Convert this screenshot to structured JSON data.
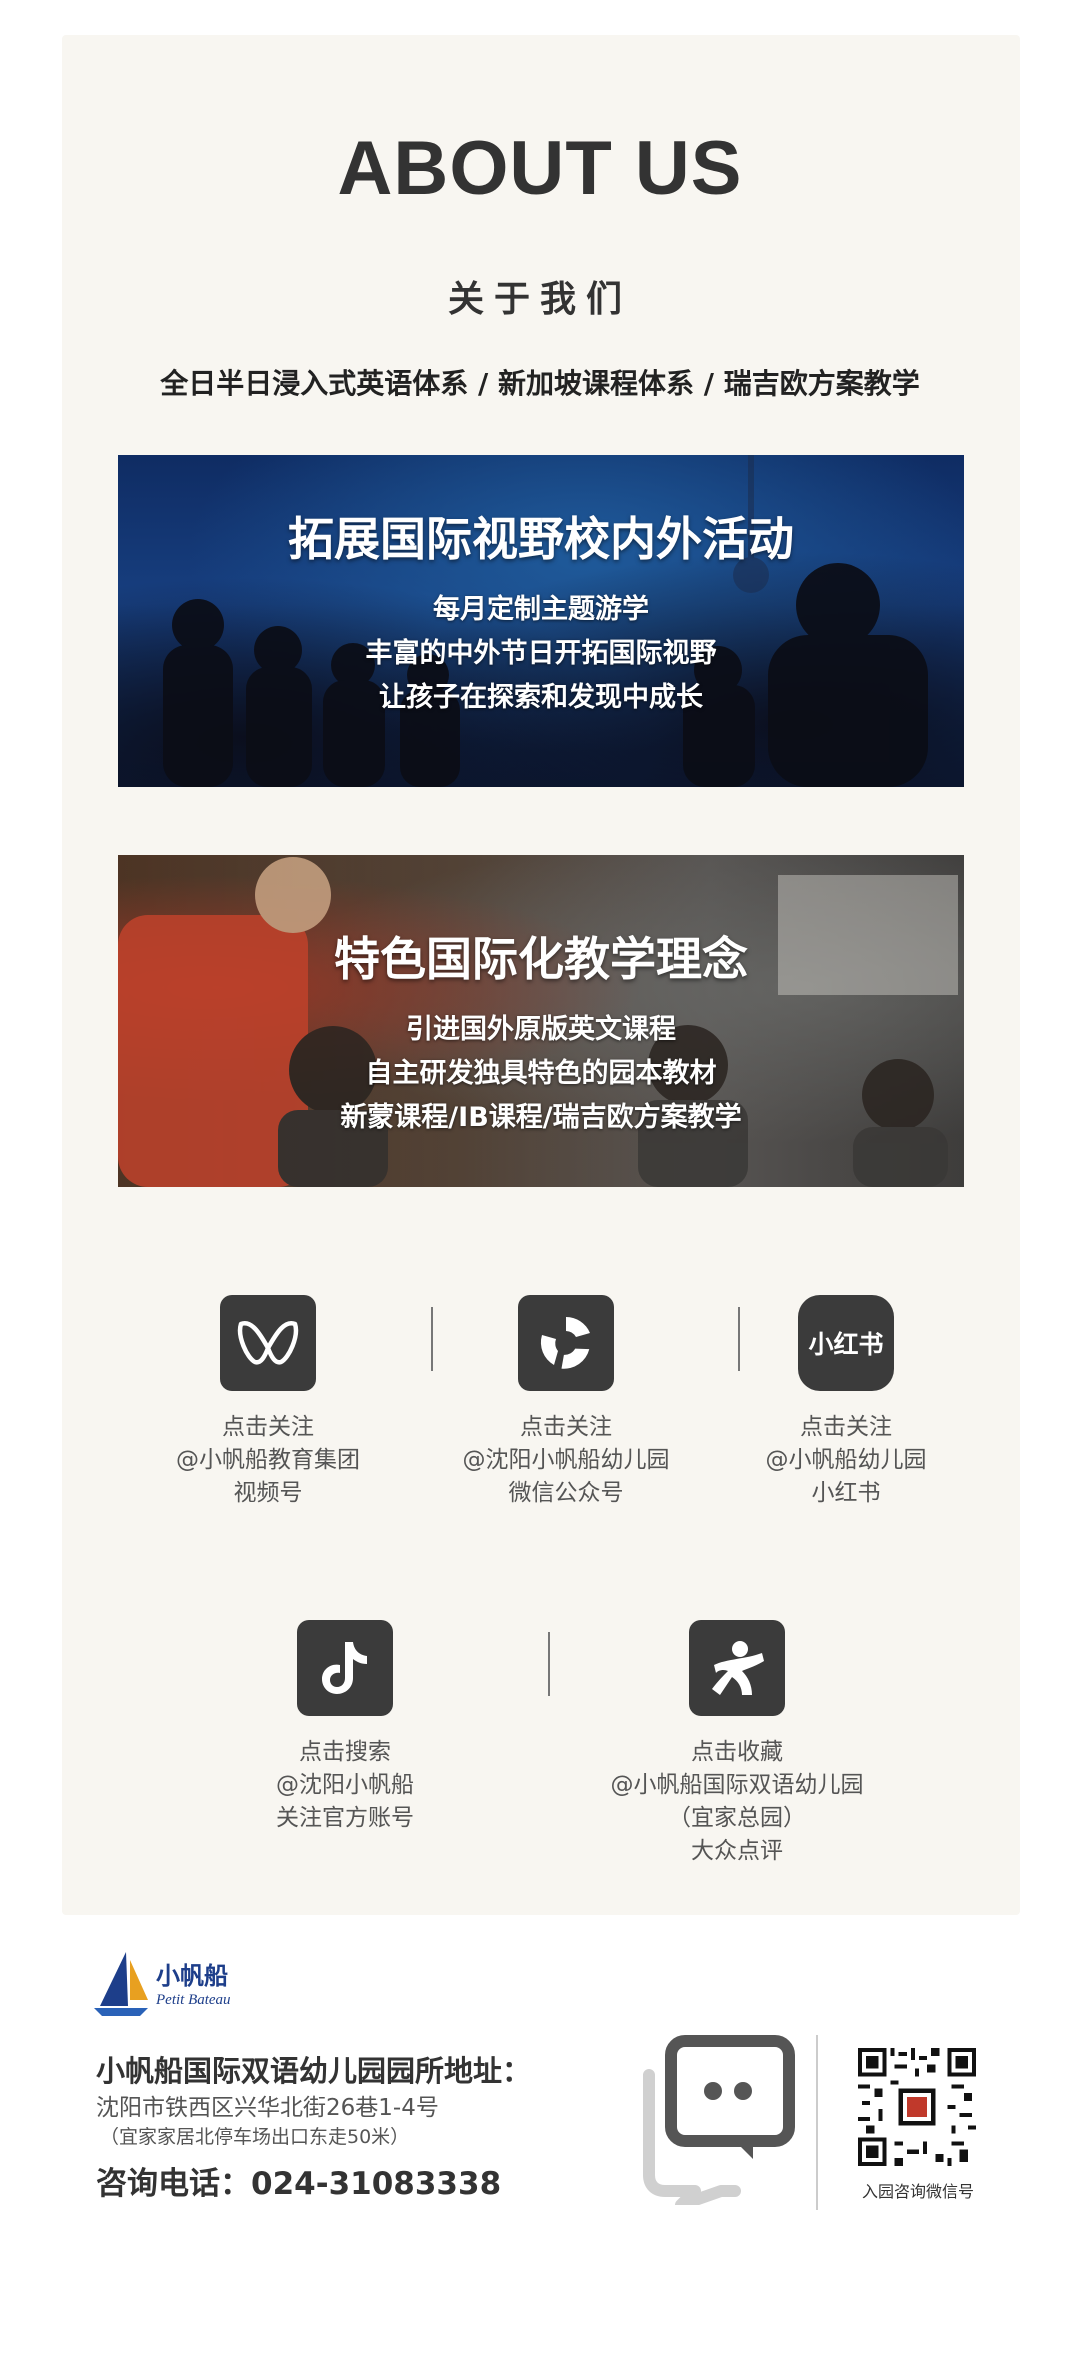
{
  "about": {
    "title": "ABOUT US",
    "subtitle": "关于我们",
    "tagline": "全日半日浸入式英语体系 / 新加坡课程体系 / 瑞吉欧方案教学"
  },
  "banners": [
    {
      "title": "拓展国际视野校内外活动",
      "lines": [
        "每月定制主题游学",
        "丰富的中外节日开拓国际视野",
        "让孩子在探索和发现中成长"
      ]
    },
    {
      "title": "特色国际化教学理念",
      "lines": [
        "引进国外原版英文课程",
        "自主研发独具特色的园本教材",
        "新蒙课程/IB课程/瑞吉欧方案教学"
      ]
    }
  ],
  "social": [
    {
      "icon": "wechat-channels-icon",
      "lines": [
        "点击关注",
        "@小帆船教育集团",
        "视频号"
      ]
    },
    {
      "icon": "wechat-official-account-icon",
      "lines": [
        "点击关注",
        "@沈阳小帆船幼儿园",
        "微信公众号"
      ]
    },
    {
      "icon": "xiaohongshu-icon",
      "icon_text": "小红书",
      "lines": [
        "点击关注",
        "@小帆船幼儿园",
        "小红书"
      ]
    },
    {
      "icon": "douyin-icon",
      "lines": [
        "点击搜索",
        "@沈阳小帆船",
        "关注官方账号"
      ]
    },
    {
      "icon": "dianping-icon",
      "lines": [
        "点击收藏",
        "@小帆船国际双语幼儿园",
        "（宜家总园）",
        "大众点评"
      ]
    }
  ],
  "footer": {
    "logo_cn": "小帆船",
    "logo_en": "Petit Bateau",
    "address_title": "小帆船国际双语幼儿园园所地址：",
    "address": "沈阳市铁西区兴华北街26巷1-4号",
    "address_note": "（宜家家居北停车场出口东走50米）",
    "phone": "咨询电话：024-31083338",
    "qr_label": "入园咨询微信号"
  }
}
